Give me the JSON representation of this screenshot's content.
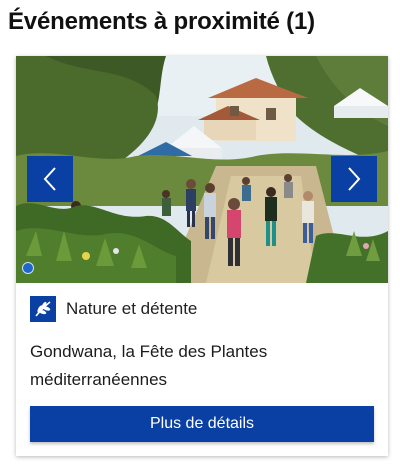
{
  "section": {
    "title": "Événements à proximité (1)"
  },
  "card": {
    "image_alt": "Photo de l'événement",
    "category_label": "Nature et détente",
    "category_icon": "olive-branch-icon",
    "title": "Gondwana, la Fête des Plantes méditerranéennes",
    "details_button_label": "Plus de détails",
    "carousel": {
      "slide_count_visible": 1,
      "active_index": 0
    }
  },
  "colors": {
    "accent": "#0a3fa3",
    "dot": "#1f66c6"
  }
}
